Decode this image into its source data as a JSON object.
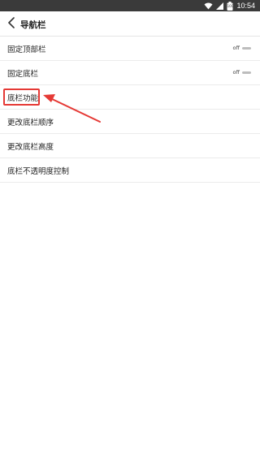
{
  "status_bar": {
    "time": "10:54",
    "battery_level": "100",
    "icons": [
      "wifi-icon",
      "signal-icon",
      "battery-icon"
    ]
  },
  "app_bar": {
    "title": "导航栏",
    "back_icon": "chevron-left-icon"
  },
  "settings": [
    {
      "label": "固定顶部栏",
      "toggle": "off"
    },
    {
      "label": "固定底栏",
      "toggle": "off"
    },
    {
      "label": "底栏功能"
    },
    {
      "label": "更改底栏顺序"
    },
    {
      "label": "更改底栏高度"
    },
    {
      "label": "底栏不透明度控制"
    }
  ],
  "annotation": {
    "color": "#e53935",
    "target": "底栏功能"
  }
}
